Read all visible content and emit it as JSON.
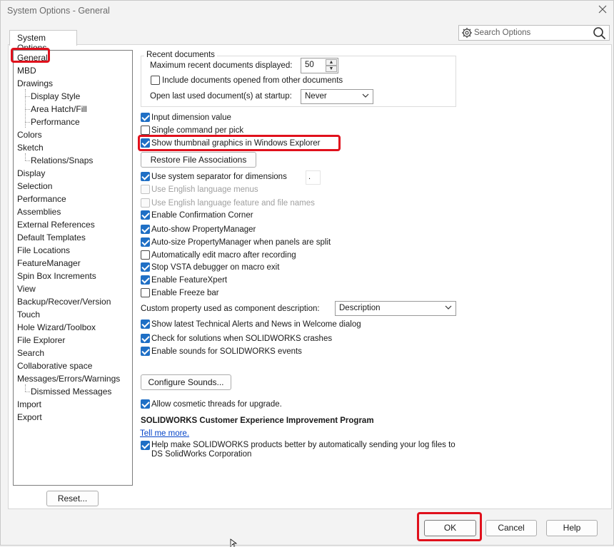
{
  "window": {
    "title": "System Options - General"
  },
  "tab": {
    "label": "System Options"
  },
  "search": {
    "placeholder": "Search Options"
  },
  "tree": {
    "items": [
      {
        "label": "General"
      },
      {
        "label": "MBD"
      },
      {
        "label": "Drawings"
      },
      {
        "label": "Display Style"
      },
      {
        "label": "Area Hatch/Fill"
      },
      {
        "label": "Performance"
      },
      {
        "label": "Colors"
      },
      {
        "label": "Sketch"
      },
      {
        "label": "Relations/Snaps"
      },
      {
        "label": "Display"
      },
      {
        "label": "Selection"
      },
      {
        "label": "Performance"
      },
      {
        "label": "Assemblies"
      },
      {
        "label": "External References"
      },
      {
        "label": "Default Templates"
      },
      {
        "label": "File Locations"
      },
      {
        "label": "FeatureManager"
      },
      {
        "label": "Spin Box Increments"
      },
      {
        "label": "View"
      },
      {
        "label": "Backup/Recover/Version"
      },
      {
        "label": "Touch"
      },
      {
        "label": "Hole Wizard/Toolbox"
      },
      {
        "label": "File Explorer"
      },
      {
        "label": "Search"
      },
      {
        "label": "Collaborative space"
      },
      {
        "label": "Messages/Errors/Warnings"
      },
      {
        "label": "Dismissed Messages"
      },
      {
        "label": "Import"
      },
      {
        "label": "Export"
      }
    ]
  },
  "recent": {
    "legend": "Recent documents",
    "max_label": "Maximum recent documents displayed:",
    "max_value": "50",
    "include_label": "Include documents opened from other documents",
    "include_checked": false,
    "open_last_label": "Open last used document(s) at startup:",
    "open_last_value": "Never"
  },
  "options": {
    "input_dimension": {
      "label": "Input dimension value",
      "checked": true
    },
    "single_command": {
      "label": "Single command per pick",
      "checked": false
    },
    "show_thumbnail": {
      "label": "Show thumbnail graphics in Windows Explorer",
      "checked": true
    },
    "restore_assoc": {
      "label": "Restore File Associations"
    },
    "system_separator": {
      "label": "Use system separator for dimensions",
      "checked": true,
      "separator": "."
    },
    "english_menus": {
      "label": "Use English language menus",
      "checked": false,
      "disabled": true
    },
    "english_feature": {
      "label": "Use English language feature and file names",
      "checked": false,
      "disabled": true
    },
    "confirmation_corner": {
      "label": "Enable Confirmation Corner",
      "checked": true
    },
    "auto_show_pm": {
      "label": "Auto-show PropertyManager",
      "checked": true
    },
    "auto_size_pm": {
      "label": "Auto-size PropertyManager when panels are split",
      "checked": true
    },
    "auto_edit_macro": {
      "label": "Automatically edit macro after recording",
      "checked": false
    },
    "stop_vsta": {
      "label": "Stop VSTA debugger on macro exit",
      "checked": true
    },
    "featurexpert": {
      "label": "Enable FeatureXpert",
      "checked": true
    },
    "freeze_bar": {
      "label": "Enable Freeze bar",
      "checked": false
    },
    "custom_property_label": "Custom property used as component description:",
    "custom_property_value": "Description",
    "show_alerts": {
      "label": "Show latest Technical Alerts and News in Welcome dialog",
      "checked": true
    },
    "check_solutions": {
      "label": "Check for solutions when SOLIDWORKS crashes",
      "checked": true
    },
    "enable_sounds": {
      "label": "Enable sounds for SOLIDWORKS events",
      "checked": true
    },
    "configure_sounds": {
      "label": "Configure Sounds..."
    },
    "cosmetic_threads": {
      "label": "Allow cosmetic threads for upgrade.",
      "checked": true
    },
    "ceip_heading": "SOLIDWORKS Customer Experience Improvement Program",
    "tell_me_more": "Tell me more.",
    "ceip_line1": "Help make SOLIDWORKS products better by automatically sending your log files to",
    "ceip_line2": "DS SolidWorks Corporation",
    "ceip_checked": true
  },
  "buttons": {
    "reset": "Reset...",
    "ok": "OK",
    "cancel": "Cancel",
    "help": "Help"
  },
  "colors": {
    "accent": "#1f6fc5",
    "highlight": "#e0101c",
    "link": "#0645c8"
  }
}
